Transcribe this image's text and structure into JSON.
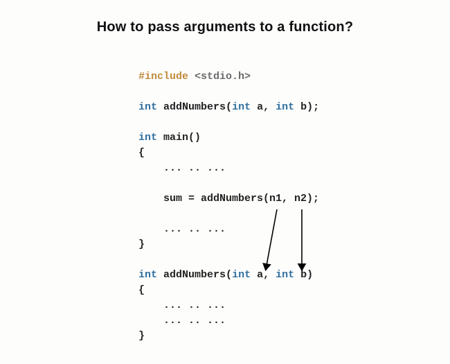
{
  "title": "How to pass arguments to a function?",
  "code": {
    "include_kw": "#include",
    "include_hdr": "<stdio.h>",
    "int_kw": "int",
    "fn_name": "addNumbers",
    "proto_params": "a, ",
    "proto_params2": "b);",
    "main_name": "main",
    "open_paren": "(",
    "close_paren_semi": ")",
    "brace_open": "{",
    "brace_close": "}",
    "ellipsis": "... .. ...",
    "sum_call": "sum = addNumbers(n1, n2);",
    "def_a": "a, ",
    "def_b": "b)",
    "comma_sp": ", ",
    "semi": ";",
    "space": " "
  }
}
